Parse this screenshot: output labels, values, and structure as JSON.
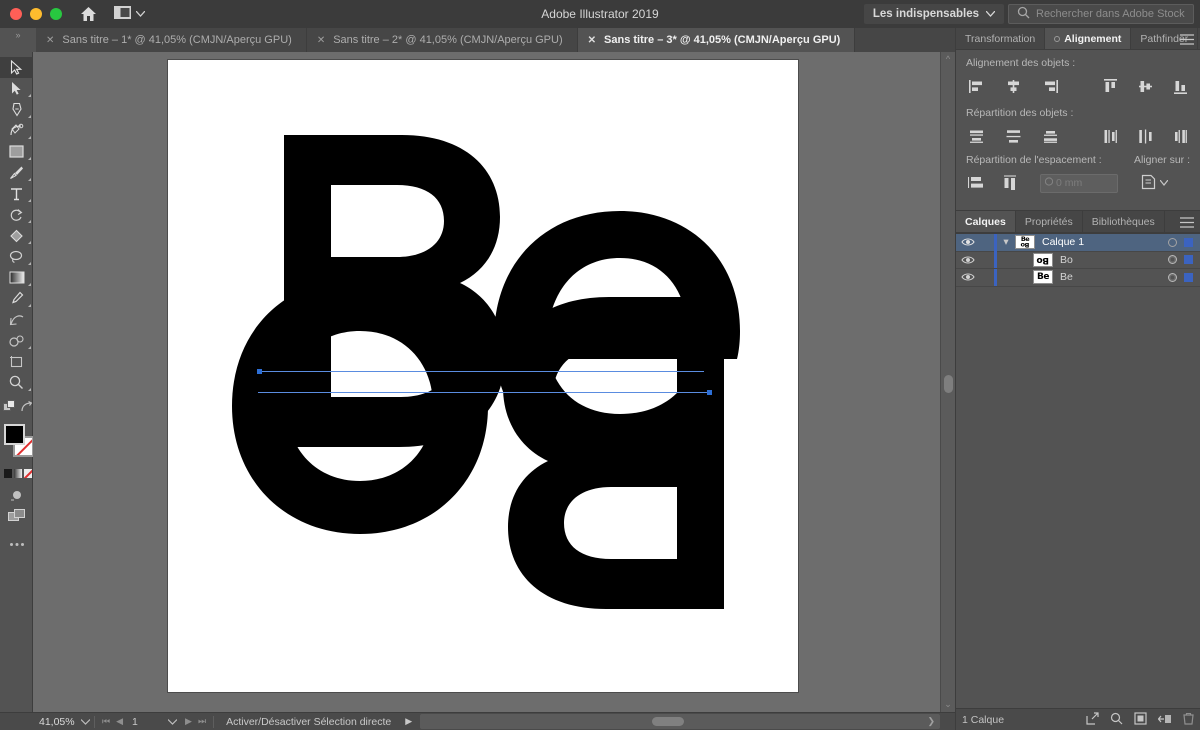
{
  "titlebar": {
    "app_title": "Adobe Illustrator 2019",
    "home_icon": "home-icon",
    "panel_layout_icon": "panel-layout-icon",
    "panel_layout_chevron": "chevron-down-icon",
    "workspace": "Les indispensables",
    "workspace_chevron": "chevron-down-icon",
    "search_icon": "search-icon",
    "search_placeholder": "Rechercher dans Adobe Stock",
    "search_value": ""
  },
  "tabbar": {
    "grip": "»",
    "tabs": [
      {
        "close": "✕",
        "label": "Sans titre – 1* @ 41,05% (CMJN/Aperçu GPU)",
        "active": false
      },
      {
        "close": "✕",
        "label": "Sans titre – 2* @ 41,05% (CMJN/Aperçu GPU)",
        "active": false
      },
      {
        "close": "✕",
        "label": "Sans titre – 3* @ 41,05% (CMJN/Aperçu GPU)",
        "active": true
      }
    ]
  },
  "toolbar": {
    "tools": [
      {
        "name": "selection-tool",
        "selected": true,
        "corner": false
      },
      {
        "name": "direct-selection-tool",
        "selected": false,
        "corner": true
      },
      {
        "name": "pen-tool",
        "selected": false,
        "corner": true
      },
      {
        "name": "curvature-tool",
        "selected": false,
        "corner": true
      },
      {
        "name": "rectangle-tool",
        "selected": false,
        "corner": true
      },
      {
        "name": "paintbrush-tool",
        "selected": false,
        "corner": true
      },
      {
        "name": "type-tool",
        "selected": false,
        "corner": true
      },
      {
        "name": "rotate-tool",
        "selected": false,
        "corner": true
      },
      {
        "name": "shape-builder-tool",
        "selected": false,
        "corner": true
      },
      {
        "name": "lasso-tool",
        "selected": false,
        "corner": true
      },
      {
        "name": "gradient-tool",
        "selected": false,
        "corner": true
      },
      {
        "name": "eyedropper-tool",
        "selected": false,
        "corner": true
      },
      {
        "name": "free-transform-tool",
        "selected": false,
        "corner": false
      },
      {
        "name": "symbol-sprayer-tool",
        "selected": false,
        "corner": true
      },
      {
        "name": "artboard-tool",
        "selected": false,
        "corner": false
      },
      {
        "name": "zoom-tool",
        "selected": false,
        "corner": true
      }
    ],
    "swap_fill_stroke_icon": "swap-fill-stroke-icon",
    "default_fill_stroke_icon": "default-fill-stroke-icon",
    "fill_color": "#000000",
    "stroke_color": "#ffffff",
    "color_mode_icon": "color-mode-icon",
    "gradient_mode_icon": "gradient-mode-icon",
    "none_mode_icon": "none-mode-icon",
    "draw_mode_icon": "draw-normal-icon",
    "screen_mode_icon": "screen-mode-icon",
    "more_tools_icon": "more-tools-icon"
  },
  "canvas": {
    "artwork": [
      {
        "name": "glyph-B-upper",
        "text": "B"
      },
      {
        "name": "glyph-e-upper",
        "text": "e"
      },
      {
        "name": "glyph-o-lower-rotated",
        "text": "o"
      },
      {
        "name": "glyph-B-lower-rotated",
        "text": "B"
      }
    ],
    "selection_color": "#5a8ce0",
    "anchor_color": "#2d6fd6",
    "vscroll_up_icon": "chevron-up-icon",
    "vscroll_down_icon": "chevron-down-icon"
  },
  "align_panel": {
    "tabs": [
      {
        "label": "Transformation",
        "active": false,
        "dot": false
      },
      {
        "label": "Alignement",
        "active": true,
        "dot": true
      },
      {
        "label": "Pathfinder",
        "active": false,
        "dot": false
      }
    ],
    "menu_icon": "panel-menu-icon",
    "objects_label": "Alignement des objets :",
    "object_align_left_icons": [
      "align-left-icon",
      "align-center-horizontal-icon",
      "align-right-icon"
    ],
    "object_align_right_icons": [
      "align-top-icon",
      "align-middle-vertical-icon",
      "align-bottom-icon"
    ],
    "distribute_label": "Répartition des objets :",
    "distribute_left_icons": [
      "distribute-top-icon",
      "distribute-vertical-center-icon",
      "distribute-bottom-icon"
    ],
    "distribute_right_icons": [
      "distribute-left-icon",
      "distribute-horizontal-center-icon",
      "distribute-right-icon"
    ],
    "spacing_label": "Répartition de l'espacement :",
    "spacing_icons": [
      "distribute-vertical-space-icon",
      "distribute-horizontal-space-icon"
    ],
    "spacing_value": "0 mm",
    "spacing_chevron": "chevron-down-icon",
    "align_to_label": "Aligner sur :",
    "align_to_icon": "align-to-artboard-icon",
    "align_to_chevron": "chevron-down-icon"
  },
  "layers_panel": {
    "tabs": [
      {
        "label": "Calques",
        "active": true
      },
      {
        "label": "Propriétés",
        "active": false
      },
      {
        "label": "Bibliothèques",
        "active": false
      }
    ],
    "menu_icon": "panel-menu-icon",
    "rows": [
      {
        "name": "Calque 1",
        "active": true,
        "is_group": true,
        "eye_icon": "eye-icon",
        "chevron": "▾",
        "thumb_text": "Be",
        "thumb_text2": "Bo",
        "target_icon": "target-circle-icon",
        "color": "#3b63c0"
      },
      {
        "name": "Bo",
        "active": false,
        "is_group": false,
        "eye_icon": "eye-icon",
        "chevron": "",
        "thumb_text": "Bo",
        "target_icon": "target-circle-icon",
        "color": "#3b63c0"
      },
      {
        "name": "Be",
        "active": false,
        "is_group": false,
        "eye_icon": "eye-icon",
        "chevron": "",
        "thumb_text": "Be",
        "target_icon": "target-circle-icon",
        "color": "#3b63c0"
      }
    ],
    "footer_count": "1 Calque",
    "footer_icons": [
      "locate-object-icon",
      "make-clipping-mask-icon",
      "create-new-sublayer-icon",
      "create-new-layer-icon",
      "delete-selection-icon"
    ]
  },
  "statusbar": {
    "zoom_value": "41,05%",
    "zoom_chevron": "chevron-down-icon",
    "first_page_icon": "first-page-icon",
    "prev_page_icon": "prev-page-icon",
    "page_value": "1",
    "page_chevron": "chevron-down-icon",
    "next_page_icon": "next-page-icon",
    "last_page_icon": "last-page-icon",
    "status_text": "Activer/Désactiver Sélection directe",
    "status_play_icon": "play-icon",
    "status_prev_icon": "chevron-left-icon",
    "hscroll_right_icon": "chevron-right-icon"
  }
}
